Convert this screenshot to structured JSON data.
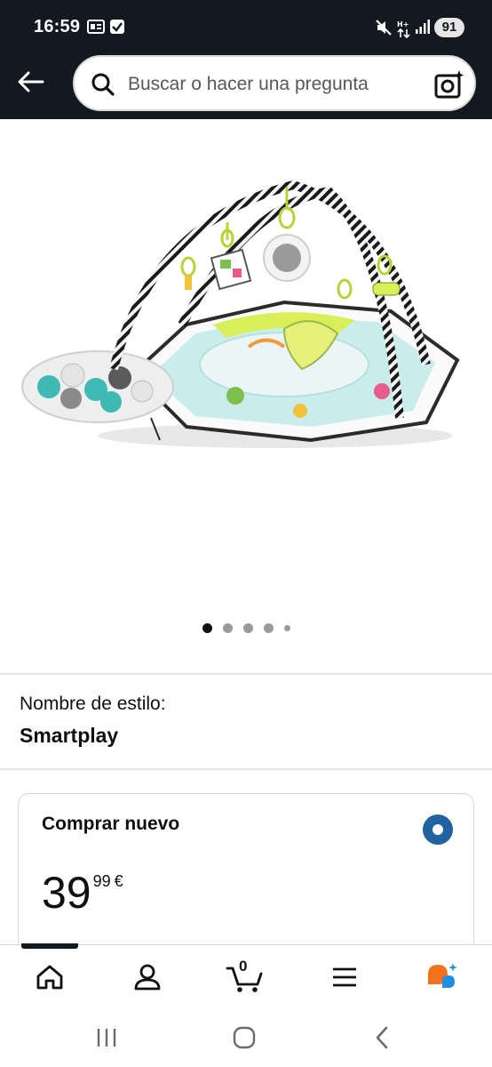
{
  "status_bar": {
    "time": "16:59",
    "battery": "91"
  },
  "header": {
    "search_placeholder": "Buscar o hacer una pregunta"
  },
  "carousel": {
    "dot_count": 5,
    "active_index": 0
  },
  "style": {
    "label": "Nombre de estilo:",
    "value": "Smartplay"
  },
  "buy_box": {
    "title": "Comprar nuevo",
    "price_whole": "39",
    "price_fraction": "99",
    "currency": "€",
    "selected": true
  },
  "bottom_nav": {
    "cart_count": "0",
    "items": [
      "home-icon",
      "account-icon",
      "cart-icon",
      "menu-icon",
      "rufus-icon"
    ]
  },
  "colors": {
    "header_bg": "#131921",
    "radio_selected": "#2162a1",
    "rufus_orange": "#f2711c",
    "rufus_blue": "#1f8fe6"
  }
}
